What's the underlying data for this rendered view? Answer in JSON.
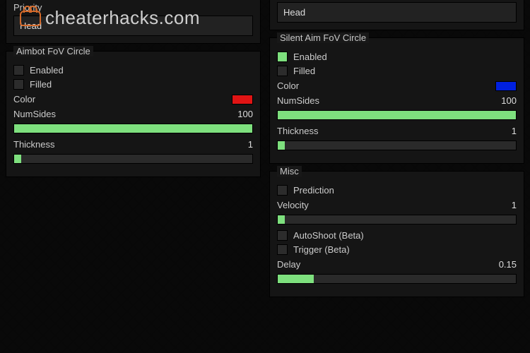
{
  "watermark": "cheaterhacks.com",
  "left": {
    "priority": {
      "label": "Priority",
      "value": "Head"
    },
    "fov": {
      "title": "Aimbot FoV Circle",
      "enabled": {
        "label": "Enabled",
        "checked": false
      },
      "filled": {
        "label": "Filled",
        "checked": false
      },
      "color": {
        "label": "Color",
        "hex": "#e01414"
      },
      "numSides": {
        "label": "NumSides",
        "value": 100,
        "pct": 100
      },
      "thickness": {
        "label": "Thickness",
        "value": 1,
        "pct": 3
      }
    }
  },
  "right": {
    "headDropdown": {
      "value": "Head"
    },
    "fov": {
      "title": "Silent Aim FoV Circle",
      "enabled": {
        "label": "Enabled",
        "checked": true
      },
      "filled": {
        "label": "Filled",
        "checked": false
      },
      "color": {
        "label": "Color",
        "hex": "#0020e0"
      },
      "numSides": {
        "label": "NumSides",
        "value": 100,
        "pct": 100
      },
      "thickness": {
        "label": "Thickness",
        "value": 1,
        "pct": 3
      }
    },
    "misc": {
      "title": "Misc",
      "prediction": {
        "label": "Prediction",
        "checked": false
      },
      "velocity": {
        "label": "Velocity",
        "value": 1,
        "pct": 3
      },
      "autoshoot": {
        "label": "AutoShoot (Beta)",
        "checked": false
      },
      "trigger": {
        "label": "Trigger (Beta)",
        "checked": false
      },
      "delay": {
        "label": "Delay",
        "value": 0.15,
        "pct": 15
      }
    }
  }
}
